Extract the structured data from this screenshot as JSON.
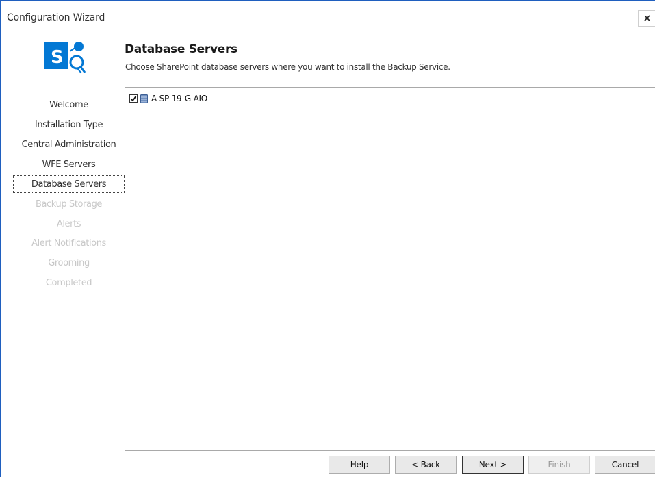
{
  "window": {
    "title": "Configuration Wizard",
    "close_symbol": "×"
  },
  "logo": {
    "name": "sharepoint-logo",
    "letter": "S",
    "brand_color": "#0378d4"
  },
  "steps": [
    {
      "label": "Welcome",
      "state": "done"
    },
    {
      "label": "Installation Type",
      "state": "done"
    },
    {
      "label": "Central Administration",
      "state": "done"
    },
    {
      "label": "WFE Servers",
      "state": "done"
    },
    {
      "label": "Database Servers",
      "state": "active"
    },
    {
      "label": "Backup Storage",
      "state": "pending"
    },
    {
      "label": "Alerts",
      "state": "pending"
    },
    {
      "label": "Alert Notifications",
      "state": "pending"
    },
    {
      "label": "Grooming",
      "state": "pending"
    },
    {
      "label": "Completed",
      "state": "pending"
    }
  ],
  "page": {
    "title": "Database Servers",
    "description": "Choose SharePoint database servers where you want to install the Backup Service."
  },
  "servers": [
    {
      "name": "A-SP-19-G-AIO",
      "checked": true,
      "icon": "database-icon"
    }
  ],
  "buttons": {
    "help": "Help",
    "back": "< Back",
    "next": "Next >",
    "finish": "Finish",
    "cancel": "Cancel"
  }
}
